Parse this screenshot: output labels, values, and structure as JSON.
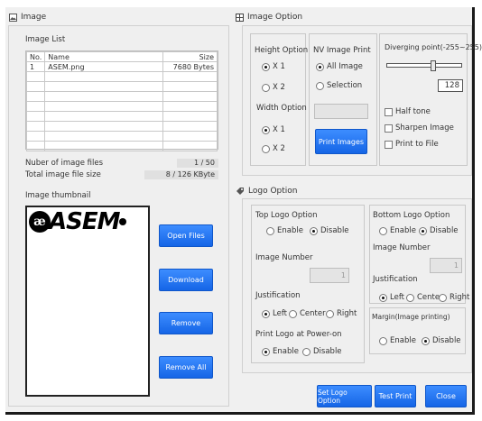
{
  "image_section": {
    "title": "Image",
    "list_label": "Image List",
    "columns": [
      "No.",
      "Name",
      "Size"
    ],
    "rows": [
      {
        "no": "1",
        "name": "ASEM.png",
        "size": "7680 Bytes"
      }
    ],
    "num_files_label": "Nuber of image files",
    "num_files_value": "1 / 50",
    "total_size_label": "Total image file size",
    "total_size_value": "8 / 126 KByte",
    "thumbnail_label": "Image thumbnail",
    "logo_text": "ASEM",
    "buttons": {
      "open": "Open Files",
      "download": "Download",
      "remove": "Remove",
      "remove_all": "Remove All"
    }
  },
  "image_option": {
    "title": "Image Option",
    "height_option": {
      "label": "Height Option",
      "x1": "X 1",
      "x2": "X 2"
    },
    "width_option": {
      "label": "Width Option",
      "x1": "X 1",
      "x2": "X 2"
    },
    "nv_print": {
      "label": "NV Image Print",
      "all": "All Image",
      "selection": "Selection",
      "button": "Print Images"
    },
    "diverging": {
      "label": "Diverging point(-255~255)",
      "value": "128",
      "slider_fraction": 0.63
    },
    "half_tone": "Half tone",
    "sharpen": "Sharpen Image",
    "print_to_file": "Print to File"
  },
  "logo_option": {
    "title": "Logo Option",
    "top": {
      "label": "Top Logo Option",
      "enable": "Enable",
      "disable": "Disable",
      "image_number": "Image Number",
      "justification": "Justification",
      "left": "Left",
      "center": "Center",
      "right": "Right",
      "power_on": "Print Logo at Power-on",
      "power_enable": "Enable",
      "power_disable": "Disable"
    },
    "bottom": {
      "label": "Bottom Logo Option",
      "enable": "Enable",
      "disable": "Disable",
      "image_number": "Image Number",
      "justification": "Justification",
      "left": "Left",
      "center": "Center",
      "right": "Right"
    },
    "margin": {
      "label": "Margin(Image printing)",
      "enable": "Enable",
      "disable": "Disable"
    },
    "spinner_value": "1"
  },
  "footer": {
    "set_logo": "Set Logo Option",
    "test_print": "Test Print",
    "close": "Close"
  }
}
